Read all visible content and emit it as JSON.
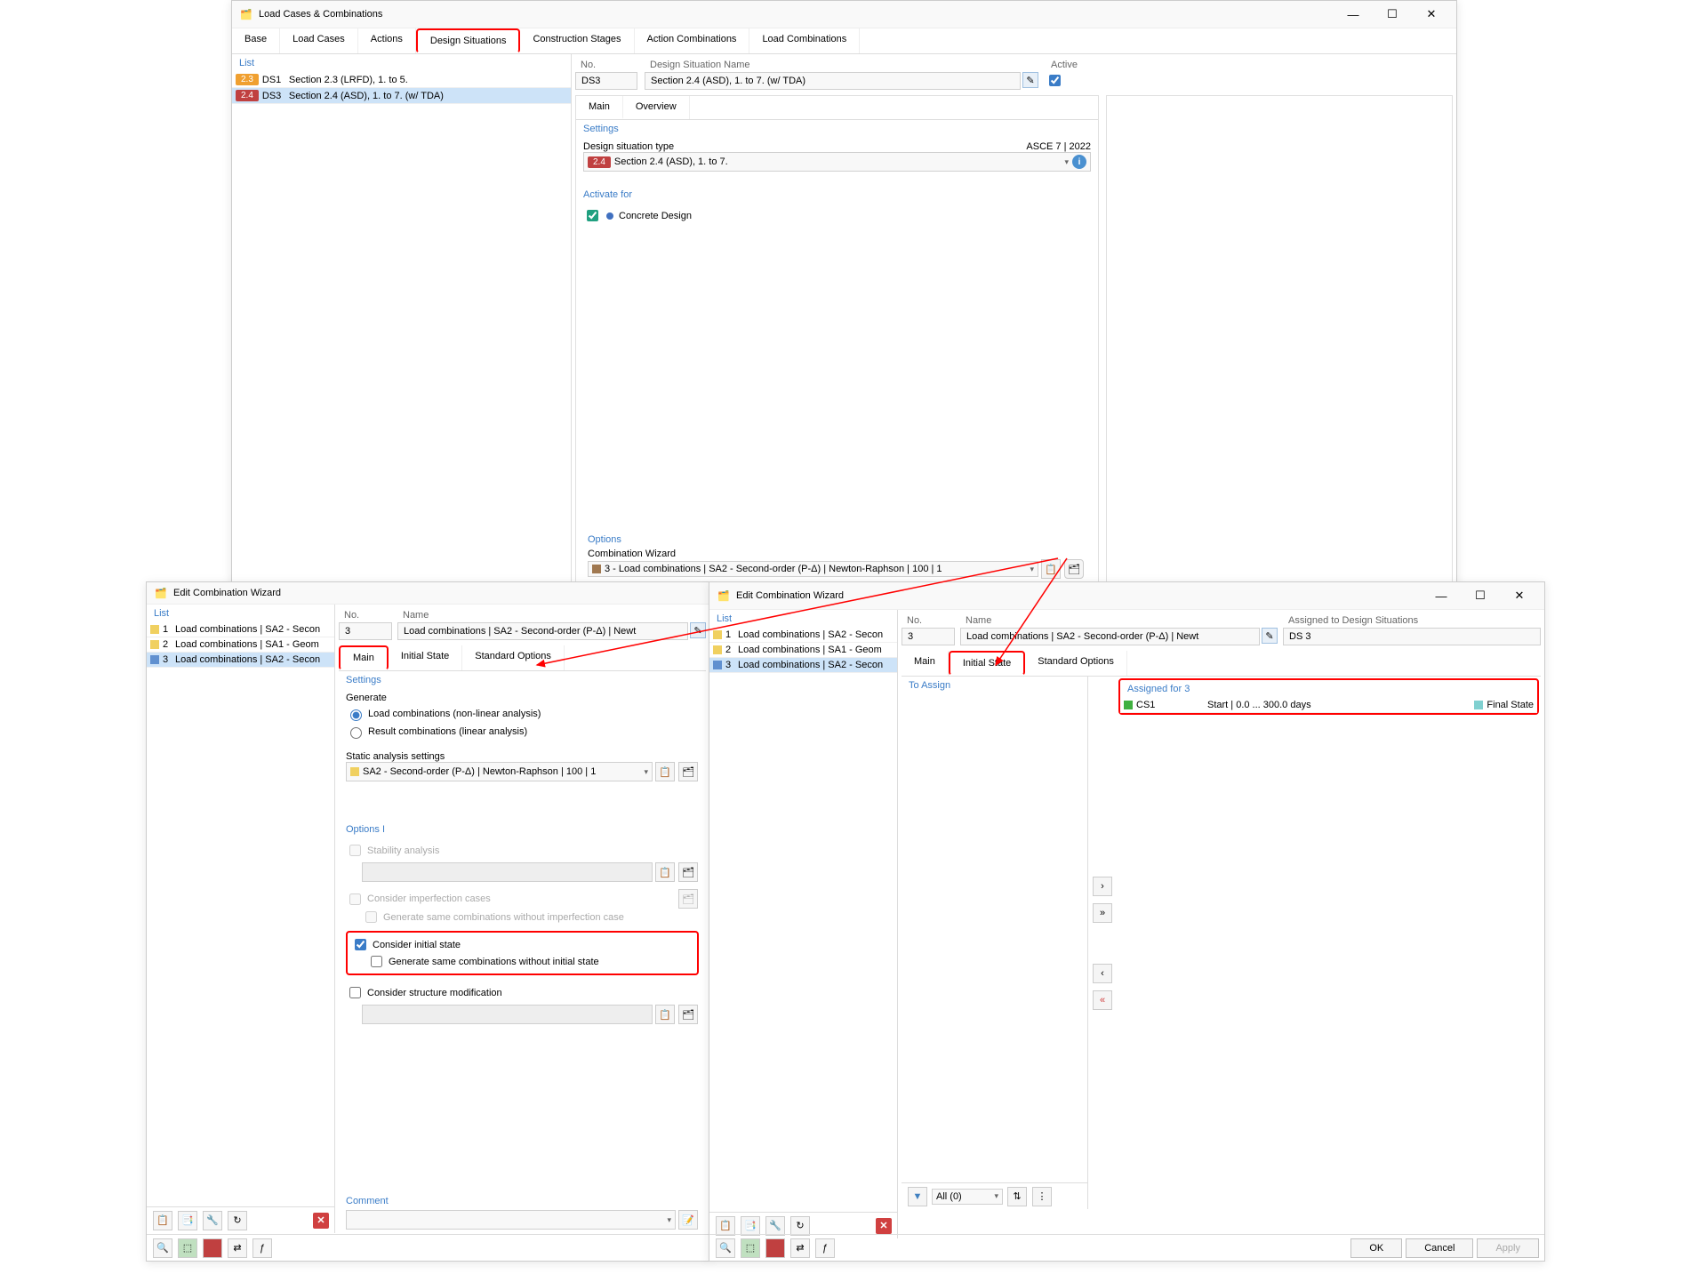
{
  "mainWindow": {
    "title": "Load Cases & Combinations",
    "tabs": [
      "Base",
      "Load Cases",
      "Actions",
      "Design Situations",
      "Construction Stages",
      "Action Combinations",
      "Load Combinations"
    ],
    "activeTab": "Design Situations",
    "list": {
      "header": "List",
      "rows": [
        {
          "badge": "2.3",
          "badgeClass": "badge-orange",
          "code": "DS1",
          "name": "Section 2.3 (LRFD), 1. to 5."
        },
        {
          "badge": "2.4",
          "badgeClass": "badge-red",
          "code": "DS3",
          "name": "Section 2.4 (ASD), 1. to 7. (w/ TDA)",
          "selected": true
        }
      ]
    },
    "detail": {
      "noLabel": "No.",
      "noValue": "DS3",
      "nameLabel": "Design Situation Name",
      "nameValue": "Section 2.4 (ASD), 1. to 7. (w/ TDA)",
      "activeLabel": "Active",
      "subtabs": [
        "Main",
        "Overview"
      ],
      "settingsHeader": "Settings",
      "designSitLabel": "Design situation type",
      "designSitStd": "ASCE 7 | 2022",
      "designSitValue": "Section 2.4 (ASD), 1. to 7.",
      "designSitBadge": "2.4",
      "activateForHeader": "Activate for",
      "activateForValue": "Concrete Design",
      "optionsHeader": "Options",
      "comboWizardLabel": "Combination Wizard",
      "comboWizardValue": "3 - Load combinations | SA2 - Second-order (P-Δ) | Newton-Raphson | 100 | 1"
    }
  },
  "editWizard1": {
    "title": "Edit Combination Wizard",
    "listHeader": "List",
    "listRows": [
      {
        "n": "1",
        "text": "Load combinations | SA2 - Secon",
        "sq": "sq-yellow"
      },
      {
        "n": "2",
        "text": "Load combinations | SA1 - Geom",
        "sq": "sq-yellow"
      },
      {
        "n": "3",
        "text": "Load combinations | SA2 - Secon",
        "sq": "sq-blue",
        "selected": true
      }
    ],
    "noLabel": "No.",
    "noValue": "3",
    "nameLabel": "Name",
    "nameValue": "Load combinations | SA2 - Second-order (P-Δ) | Newt",
    "subtabs": [
      "Main",
      "Initial State",
      "Standard Options"
    ],
    "activeSubtab": "Main",
    "settingsHeader": "Settings",
    "generateHeader": "Generate",
    "generateOpt1": "Load combinations (non-linear analysis)",
    "generateOpt2": "Result combinations (linear analysis)",
    "staticLabel": "Static analysis settings",
    "staticValue": "SA2 - Second-order (P-Δ) | Newton-Raphson | 100 | 1",
    "optionsIHeader": "Options I",
    "stabilityLabel": "Stability analysis",
    "imperfLabel": "Consider imperfection cases",
    "imperfSub": "Generate same combinations without imperfection case",
    "initialStateLabel": "Consider initial state",
    "initialStateSub": "Generate same combinations without initial state",
    "structModLabel": "Consider structure modification",
    "commentHeader": "Comment"
  },
  "editWizard2": {
    "title": "Edit Combination Wizard",
    "listHeader": "List",
    "listRows": [
      {
        "n": "1",
        "text": "Load combinations | SA2 - Secon",
        "sq": "sq-yellow"
      },
      {
        "n": "2",
        "text": "Load combinations | SA1 - Geom",
        "sq": "sq-yellow"
      },
      {
        "n": "3",
        "text": "Load combinations | SA2 - Secon",
        "sq": "sq-blue",
        "selected": true
      }
    ],
    "noLabel": "No.",
    "noValue": "3",
    "nameLabel": "Name",
    "nameValue": "Load combinations | SA2 - Second-order (P-Δ) | Newt",
    "assignedLabel": "Assigned to Design Situations",
    "assignedValue": "DS 3",
    "subtabs": [
      "Main",
      "Initial State",
      "Standard Options"
    ],
    "activeSubtab": "Initial State",
    "toAssignHeader": "To Assign",
    "assignedForHeader": "Assigned for 3",
    "assignedRow": {
      "name": "CS1",
      "range": "Start | 0.0 ... 300.0 days",
      "state": "Final State"
    },
    "filterAll": "All (0)",
    "buttons": {
      "ok": "OK",
      "cancel": "Cancel",
      "apply": "Apply"
    }
  }
}
